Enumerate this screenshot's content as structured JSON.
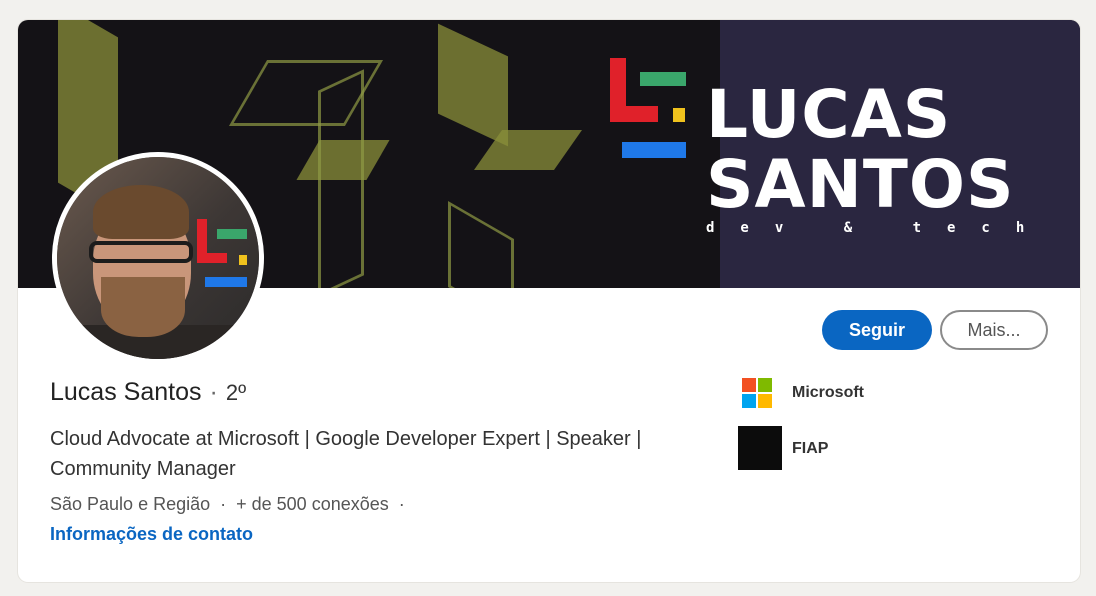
{
  "banner": {
    "brand_line1": "LUCAS",
    "brand_line2": "SANTOS",
    "brand_sub": "dev & tech"
  },
  "profile": {
    "name": "Lucas Santos",
    "separator": "·",
    "degree": "2º",
    "headline": "Cloud Advocate at Microsoft | Google Developer Expert | Speaker | Community Manager",
    "location": "São Paulo e Região",
    "connections": "+ de 500 conexões",
    "contact_link": "Informações de contato"
  },
  "actions": {
    "follow_label": "Seguir",
    "more_label": "Mais..."
  },
  "companies": [
    {
      "name": "Microsoft",
      "logo": "microsoft-logo"
    },
    {
      "name": "FIAP",
      "logo": "fiap-logo"
    }
  ],
  "colors": {
    "accent": "#0a66c2",
    "banner_bg": "#141216",
    "brand_red": "#e0212a",
    "brand_green": "#3aa66b",
    "brand_yellow": "#f0c21d",
    "brand_blue": "#1f78e8"
  }
}
